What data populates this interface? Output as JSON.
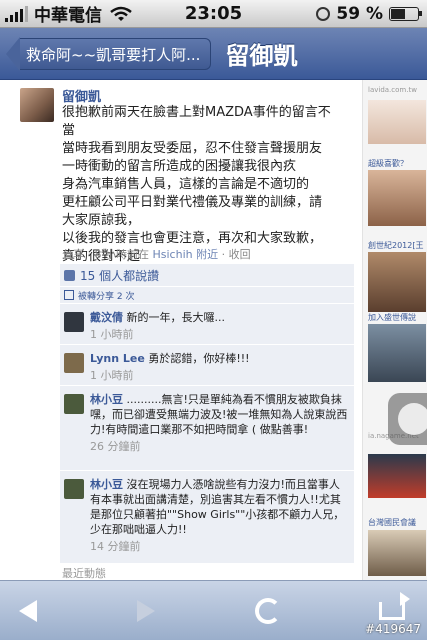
{
  "status": {
    "carrier": "中華電信",
    "time": "23:05",
    "battery_pct": "59 %",
    "battery_fill": 0.59
  },
  "nav": {
    "back_label": "救命阿~~凱哥要打人阿...",
    "title": "留御凱"
  },
  "post": {
    "author": "留御凱",
    "lines": [
      "很抱歉前兩天在臉書上對MAZDA事件的留言不",
      "當",
      "當時我看到朋友受委屈，忍不住發言聲援朋友",
      "一時衝動的留言所造成的困擾讓我很內疚",
      "身為汽車銷售人員，這樣的言論是不適切的",
      "更枉顧公司平日對業代禮儀及專業的訓練，請",
      "大家原諒我，",
      "以後我的發言也會更注意，再次和大家致歉，",
      "真的很對不起"
    ],
    "meta_prefix": "分享 · 8 小時前在 ",
    "meta_location": "Hsichih 附近",
    "meta_suffix": " · 收回"
  },
  "likes": {
    "text": "15 個人都說讚"
  },
  "shares": {
    "text": "被轉分享 2 次"
  },
  "comments": [
    {
      "name": "戴汶倩",
      "text": " 新的一年，長大囉...",
      "time": "1 小時前",
      "color": "#30363f"
    },
    {
      "name": "Lynn Lee",
      "text": " 勇於認錯，你好棒!!!",
      "time": "1 小時前",
      "color": "#7d6a4b"
    },
    {
      "name": "林小豆",
      "text": " ..........無言!只是單純為看不慣朋友被欺負抹嘿，而已卻遭受無端力波及!被一堆無知為人說東說西力!有時間遣口業那不如把時間拿 ( 做點善事!",
      "time": "26 分鐘前",
      "color": "#4b5a3c"
    },
    {
      "name": "林小豆",
      "text": " 沒在現場力人憑啥說些有力沒力!而且當事人有本事就出面講清楚，別追害其左看不慣力人!!尤其是那位只顧著拍\"\"Show Girls\"\"小孩都不顧力人兄，少在那咄咄逼人力!!",
      "time": "14 分鐘前",
      "color": "#4b5a3c"
    }
  ],
  "recent_label": "最近動態",
  "ads": {
    "lavida": "lavida.com.tw",
    "ad2": "超級喜歡？",
    "ad3": "創世紀2012[王",
    "ad4": "加入盛世傳說",
    "ad5": "ia.nagame.net",
    "ad6": "台灣國民會議"
  },
  "watermark": "#419647"
}
